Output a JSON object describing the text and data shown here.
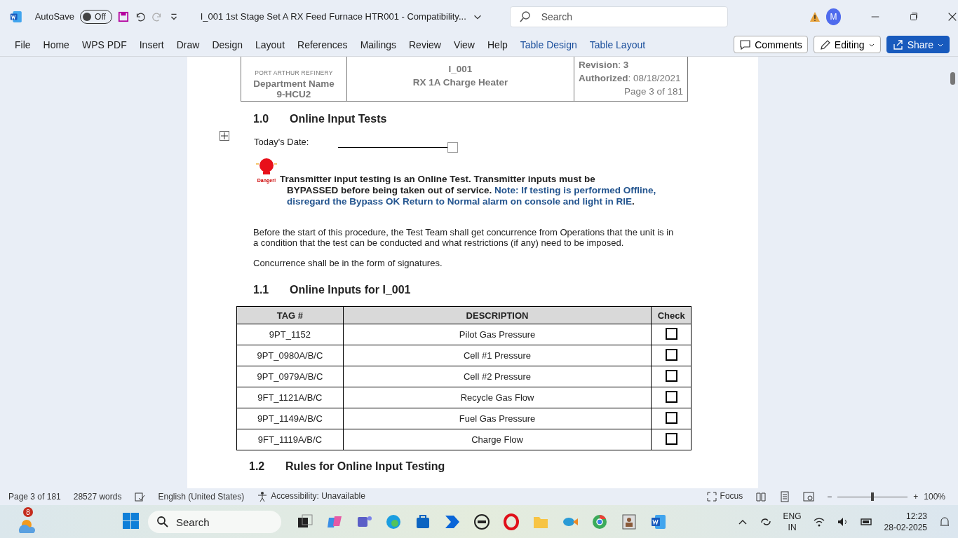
{
  "title_bar": {
    "autosave_label": "AutoSave",
    "autosave_toggle": {
      "label": "Off",
      "on": false
    },
    "document_title": "I_001 1st Stage Set A RX Feed Furnace HTR001  -  Compatibility...",
    "search": {
      "placeholder": "Search"
    },
    "avatar": "M"
  },
  "ribbon": {
    "tabs": [
      {
        "label": "File",
        "kind": "plain"
      },
      {
        "label": "Home",
        "kind": "plain"
      },
      {
        "label": "WPS PDF",
        "kind": "plain"
      },
      {
        "label": "Insert",
        "kind": "plain"
      },
      {
        "label": "Draw",
        "kind": "plain"
      },
      {
        "label": "Design",
        "kind": "plain"
      },
      {
        "label": "Layout",
        "kind": "plain"
      },
      {
        "label": "References",
        "kind": "plain"
      },
      {
        "label": "Mailings",
        "kind": "plain"
      },
      {
        "label": "Review",
        "kind": "plain"
      },
      {
        "label": "View",
        "kind": "plain"
      },
      {
        "label": "Help",
        "kind": "plain"
      },
      {
        "label": "Table Design",
        "kind": "contextual"
      },
      {
        "label": "Table Layout",
        "kind": "contextual"
      }
    ],
    "comments": "Comments",
    "editing": "Editing",
    "share": "Share"
  },
  "document": {
    "header": {
      "left": [
        "PORT ARTHUR REFINERY",
        "Department Name",
        "9-HCU2"
      ],
      "center": [
        "I_001",
        "RX 1A Charge Heater"
      ],
      "right": [
        "**Revision**: **3**",
        "**Authorized**: 08/18/2021",
        "Page 3 of 181"
      ]
    },
    "section_1": {
      "number": "1.0",
      "title": "Online Input Tests"
    },
    "date_label": "Today's Date:",
    "danger_label": "Danger!",
    "warning_line_1": "Transmitter input testing is an Online Test. Transmitter inputs must be",
    "warning_line_2": "BYPASSED before being taken out of service.",
    "note": "Note: If testing is performed Offline, disregard the Bypass OK Return to Normal alarm on console and light in RIE",
    "note_end": ".",
    "paragraph_1": "Before the start of this procedure, the Test Team shall get concurrence from Operations that the unit is in a condition that the test can be conducted and what restrictions (if any) need to be imposed.",
    "paragraph_2": "Concurrence shall be in the form of signatures.",
    "section_2": {
      "number": "1.1",
      "title": "Online Inputs for I_001"
    },
    "table": {
      "columns": [
        "TAG #",
        "DESCRIPTION",
        "Check"
      ],
      "rows": [
        {
          "tag": "9PT_1152",
          "description": "Pilot Gas Pressure",
          "checked": false
        },
        {
          "tag": "9PT_0980A/B/C",
          "description": "Cell #1 Pressure",
          "checked": false
        },
        {
          "tag": "9PT_0979A/B/C",
          "description": "Cell #2 Pressure",
          "checked": false
        },
        {
          "tag": "9FT_1121A/B/C",
          "description": "Recycle Gas Flow",
          "checked": false
        },
        {
          "tag": "9PT_1149A/B/C",
          "description": "Fuel Gas Pressure",
          "checked": false
        },
        {
          "tag": "9FT_1119A/B/C",
          "description": "Charge Flow",
          "checked": false
        }
      ]
    },
    "section_3": {
      "number": "1.2",
      "title": "Rules for Online Input Testing"
    }
  },
  "status_bar": {
    "page": "Page 3 of 181",
    "words": "28527 words",
    "language": "English (United States)",
    "accessibility": "Accessibility: Unavailable",
    "focus": "Focus",
    "zoom": {
      "out": "−",
      "in": "+",
      "level": 0.5,
      "reading": "100%"
    }
  },
  "taskbar": {
    "weather_badge": "8",
    "search": "Search",
    "language": [
      "ENG",
      "IN"
    ],
    "time": "12:23",
    "date": "28-02-2025"
  }
}
